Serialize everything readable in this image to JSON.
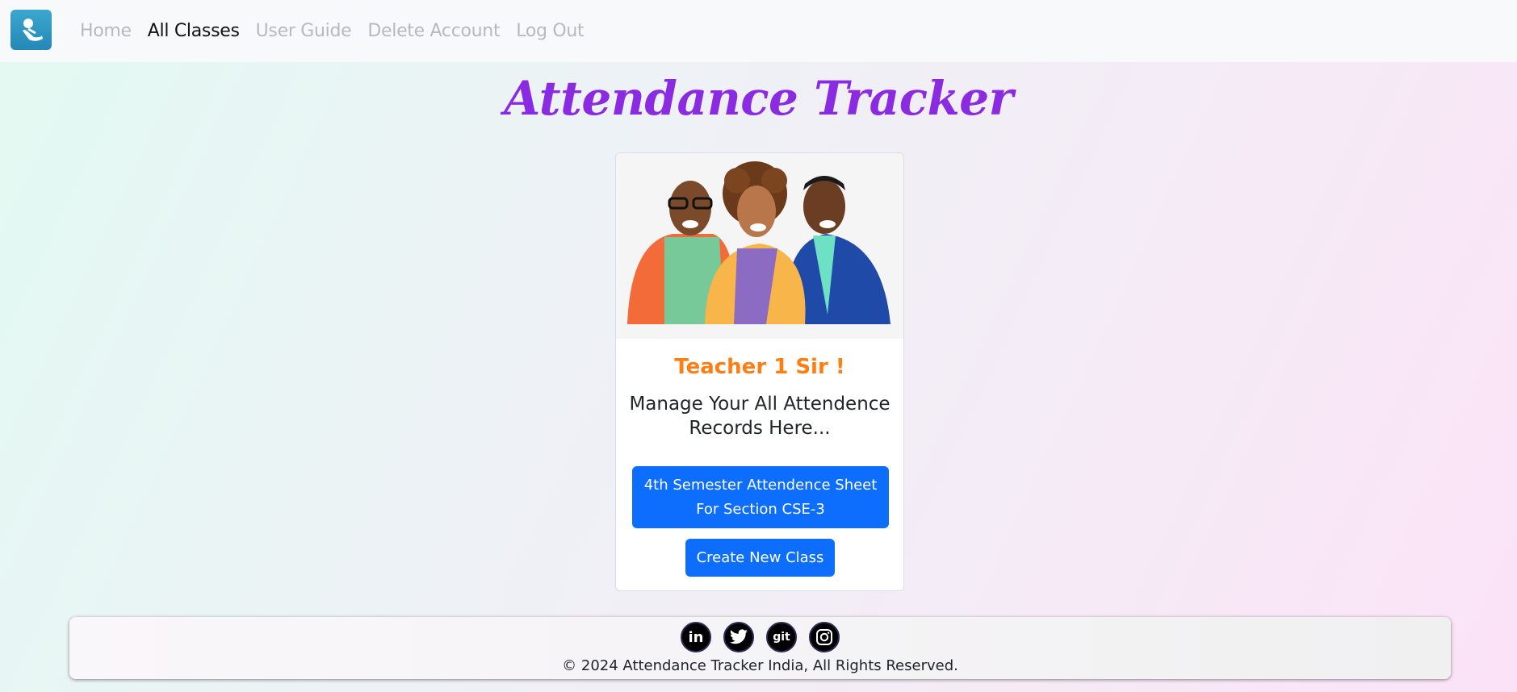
{
  "nav": {
    "links": [
      {
        "label": "Home",
        "active": false
      },
      {
        "label": "All Classes",
        "active": true
      },
      {
        "label": "User Guide",
        "active": false
      },
      {
        "label": "Delete Account",
        "active": false
      },
      {
        "label": "Log Out",
        "active": false
      }
    ],
    "logo_icon": "app-logo-icon"
  },
  "page": {
    "title": "Attendance Tracker"
  },
  "card": {
    "image": "teachers-illustration",
    "greeting": "Teacher 1 Sir !",
    "subtitle": "Manage Your All Attendence Records Here...",
    "classes": [
      {
        "label": "4th Semester Attendence Sheet For Section CSE-3"
      }
    ],
    "create_label": "Create New Class"
  },
  "footer": {
    "socials": [
      {
        "name": "linkedin-icon",
        "glyph": "in"
      },
      {
        "name": "twitter-icon",
        "glyph": ""
      },
      {
        "name": "github-icon",
        "glyph": "git"
      },
      {
        "name": "instagram-icon",
        "glyph": ""
      }
    ],
    "copyright": "© 2024 Attendance Tracker India, All Rights Reserved."
  },
  "colors": {
    "title": "#8a2be2",
    "greeting": "#fd7e14",
    "primary_button": "#0d6efd",
    "nav_inactive": "#b6b9bd"
  }
}
